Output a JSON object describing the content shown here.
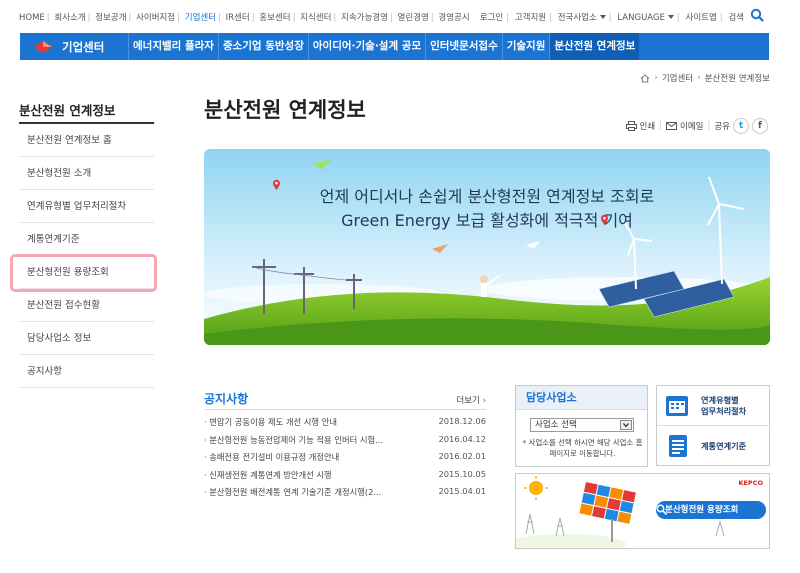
{
  "util": {
    "left_links": [
      "HOME",
      "회사소개",
      "정보공개",
      "사이버지점",
      "기업센터",
      "IR센터",
      "홍보센터",
      "지식센터",
      "지속가능경영",
      "열린경영",
      "경영공시"
    ],
    "active_link": "기업센터",
    "right_links": {
      "login": "로그인",
      "support": "고객지원",
      "sites": "전국사업소",
      "language": "LANGUAGE",
      "sitemap": "사이트맵",
      "search": "검색"
    }
  },
  "nav": {
    "brand": "기업센터",
    "menus": [
      "에너지밸리 플라자",
      "중소기업 동반성장",
      "아이디어·기술·설계 공모",
      "인터넷문서접수",
      "기술지원",
      "분산전원 연계정보"
    ],
    "current": "분산전원 연계정보"
  },
  "breadcrumb": {
    "home_icon": "home-icon",
    "level1": "기업센터",
    "level2": "분산전원 연계정보"
  },
  "sidebar": {
    "title": "분산전원 연계정보",
    "items": [
      "분산전원 연계정보 홈",
      "분산형전원 소개",
      "연계유형별 업무처리절차",
      "계통연계기준",
      "분산형전원 용량조회",
      "분산전원 접수현황",
      "담당사업소 정보",
      "공지사항"
    ],
    "highlighted": "분산형전원 용량조회"
  },
  "page": {
    "title": "분산전원 연계정보",
    "tools": {
      "print": "인쇄",
      "email": "이메일",
      "share": "공유",
      "twitter": "t",
      "facebook": "f"
    }
  },
  "banner": {
    "line1": "언제 어디서나 손쉽게 분산형전원 연계정보 조회로",
    "line2": "Green Energy 보급 활성화에 적극적 기여"
  },
  "notice": {
    "title": "공지사항",
    "more": "더보기",
    "items": [
      {
        "title": "· 변압기 공동이용 제도 개선 시행 안내",
        "date": "2018.12.06"
      },
      {
        "title": "· 분산형전원 능동전압제어 기능 적용 인버터 시험...",
        "date": "2016.04.12"
      },
      {
        "title": "· 송배전용 전기설비 이용규정 개정안내",
        "date": "2016.02.01"
      },
      {
        "title": "· 신재생전원 계통연계 방안개선 시행",
        "date": "2015.10.05"
      },
      {
        "title": "· 분산형전원 배전계통 연계 기술기준 개정시행(2...",
        "date": "2015.04.01"
      }
    ]
  },
  "office": {
    "title": "담당사업소",
    "select_value": "사업소 선택",
    "note": "* 사업소를 선택 하시면 해당 사업소 홈페이지로 이동합니다."
  },
  "quick": {
    "item1_line1": "연계유형별",
    "item1_line2": "업무처리절차",
    "item2": "계통연계기준"
  },
  "capacity": {
    "button": "분산형전원 용량조회",
    "logo": "KEPCO"
  },
  "colors": {
    "primary": "#1b74d2",
    "highlight": "#f5a8b0"
  }
}
